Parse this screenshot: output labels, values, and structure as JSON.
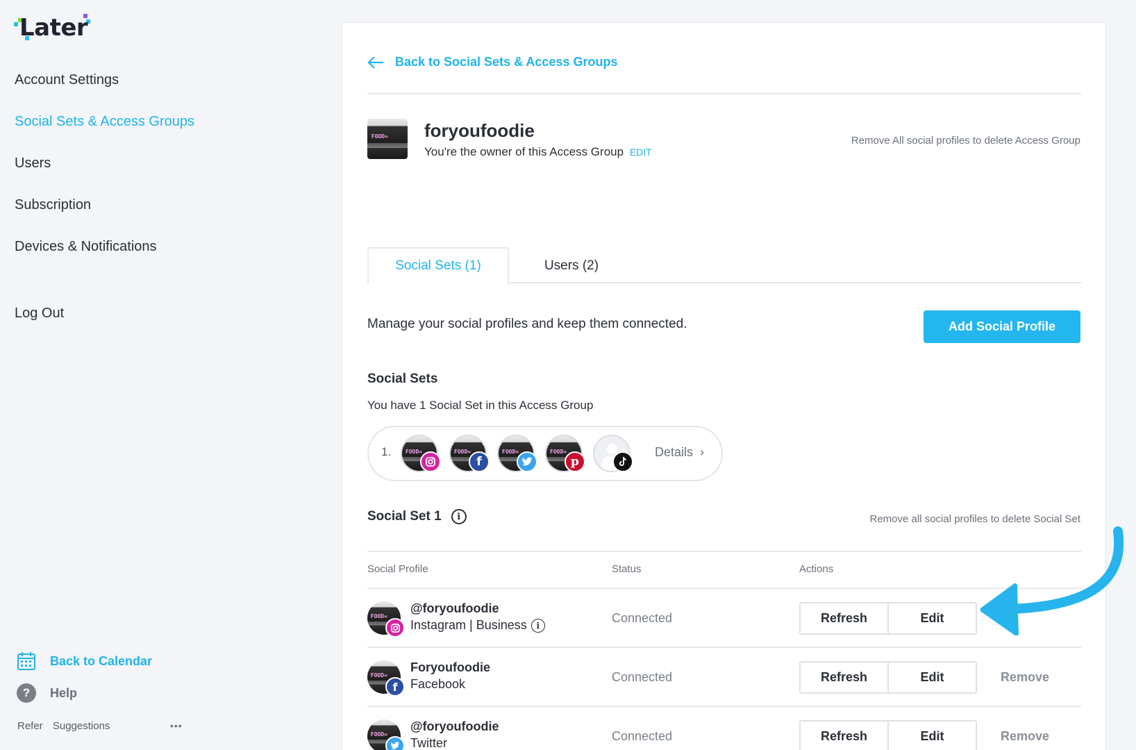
{
  "sidebar": {
    "logo_text": "Later",
    "nav": [
      {
        "label": "Account Settings",
        "active": false
      },
      {
        "label": "Social Sets & Access Groups",
        "active": true
      },
      {
        "label": "Users",
        "active": false
      },
      {
        "label": "Subscription",
        "active": false
      },
      {
        "label": "Devices & Notifications",
        "active": false
      },
      {
        "label": "Log Out",
        "active": false
      }
    ],
    "back_to_calendar": "Back to Calendar",
    "help": "Help",
    "help_icon_glyph": "?",
    "refer": "Refer",
    "suggestions": "Suggestions",
    "more_glyph": "•••"
  },
  "main": {
    "back_link": "Back to Social Sets & Access Groups",
    "group": {
      "name": "foryoufoodie",
      "owner_text": "You're the owner of this Access Group",
      "edit_label": "EDIT",
      "remove_hint": "Remove All social profiles to delete Access Group",
      "avatar_neon": "FOOD="
    },
    "tabs": [
      {
        "label": "Social Sets (1)",
        "active": true
      },
      {
        "label": "Users (2)",
        "active": false
      }
    ],
    "manage_text": "Manage your social profiles and keep them connected.",
    "add_button": "Add Social Profile",
    "social_sets_heading": "Social Sets",
    "social_sets_sub": "You have 1 Social Set in this Access Group",
    "set_pill": {
      "number": "1.",
      "avatars": [
        {
          "network": "instagram",
          "badge_color": "#d6249f"
        },
        {
          "network": "facebook",
          "badge_color": "#2d4fa3"
        },
        {
          "network": "twitter",
          "badge_color": "#3ba4ec"
        },
        {
          "network": "pinterest",
          "badge_color": "#c8102e"
        },
        {
          "network": "tiktok",
          "badge_color": "#111111"
        }
      ],
      "details_label": "Details",
      "details_chevron": "›"
    },
    "set1": {
      "heading": "Social Set 1",
      "info_glyph": "i",
      "remove_hint": "Remove all social profiles to delete Social Set"
    },
    "table": {
      "columns": [
        "Social Profile",
        "Status",
        "Actions"
      ],
      "rows": [
        {
          "name": "@foryoufoodie",
          "type": "Instagram | Business",
          "show_info": true,
          "network": "instagram",
          "badge_color": "#d6249f",
          "status": "Connected",
          "refresh": "Refresh",
          "edit": "Edit",
          "remove": ""
        },
        {
          "name": "Foryoufoodie",
          "type": "Facebook",
          "show_info": false,
          "network": "facebook",
          "badge_color": "#2d4fa3",
          "status": "Connected",
          "refresh": "Refresh",
          "edit": "Edit",
          "remove": "Remove"
        },
        {
          "name": "@foryoufoodie",
          "type": "Twitter",
          "show_info": false,
          "network": "twitter",
          "badge_color": "#3ba4ec",
          "status": "Connected",
          "refresh": "Refresh",
          "edit": "Edit",
          "remove": "Remove"
        }
      ]
    }
  },
  "colors": {
    "accent": "#1fb4e8",
    "button": "#24b6ee",
    "annotation_arrow": "#27b4ec"
  }
}
